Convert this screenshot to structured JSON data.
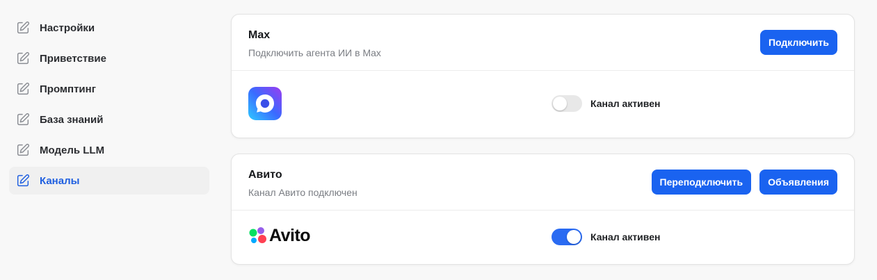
{
  "sidebar": {
    "items": [
      {
        "label": "Настройки",
        "icon": "edit-icon",
        "active": false
      },
      {
        "label": "Приветствие",
        "icon": "edit-icon",
        "active": false
      },
      {
        "label": "Промптинг",
        "icon": "edit-icon",
        "active": false
      },
      {
        "label": "База знаний",
        "icon": "edit-icon",
        "active": false
      },
      {
        "label": "Модель LLM",
        "icon": "edit-icon",
        "active": false
      },
      {
        "label": "Каналы",
        "icon": "edit-icon",
        "active": true
      }
    ]
  },
  "channels": {
    "max": {
      "title": "Max",
      "subtitle": "Подключить агента ИИ в Max",
      "connect_label": "Подключить",
      "toggle_label": "Канал активен",
      "toggle_on": false,
      "logo": "max-logo"
    },
    "avito": {
      "title": "Авито",
      "subtitle": "Канал Авито подключен",
      "reconnect_label": "Переподключить",
      "listings_label": "Объявления",
      "toggle_label": "Канал активен",
      "toggle_on": true,
      "logo_text": "Avito"
    }
  },
  "colors": {
    "accent": "#1a63f0",
    "active_nav_text": "#1f5fe0",
    "toggle_on": "#2a6bf2",
    "toggle_off": "#e8e8e8"
  }
}
